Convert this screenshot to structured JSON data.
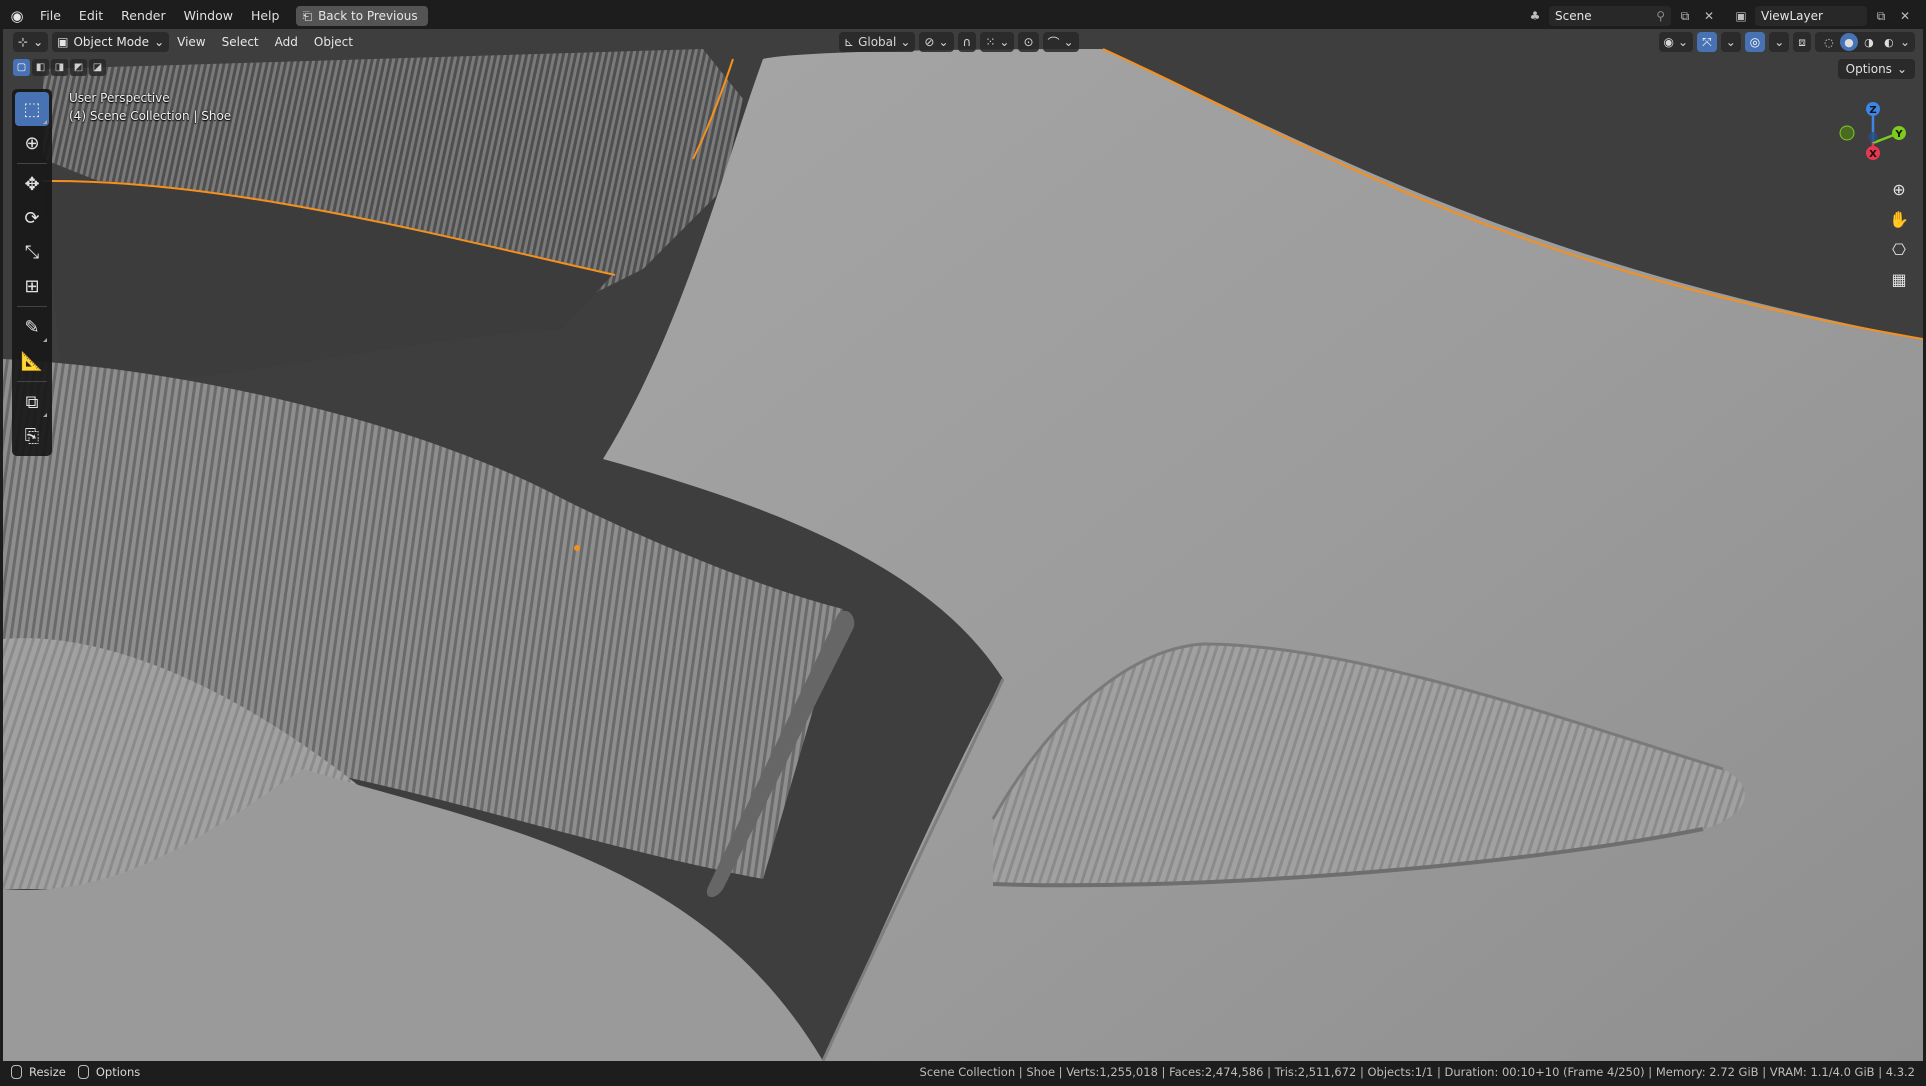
{
  "menubar": {
    "items": [
      "File",
      "Edit",
      "Render",
      "Window",
      "Help"
    ],
    "back_button": "Back to Previous",
    "scene_field": "Scene",
    "view_layer_field": "ViewLayer"
  },
  "viewport_header": {
    "mode": "Object Mode",
    "menus": [
      "View",
      "Select",
      "Add",
      "Object"
    ],
    "orientation": "Global",
    "options_label": "Options"
  },
  "overlay": {
    "view_name": "User Perspective",
    "collection_info": "(4) Scene Collection | Shoe"
  },
  "toolbar": {
    "tools": [
      {
        "icon": "select-box-icon",
        "active": true
      },
      {
        "icon": "cursor-icon"
      },
      {
        "icon": "move-icon"
      },
      {
        "icon": "rotate-icon"
      },
      {
        "icon": "scale-icon"
      },
      {
        "icon": "transform-icon"
      },
      {
        "icon": "annotate-icon"
      },
      {
        "icon": "measure-icon"
      },
      {
        "icon": "add-cube-icon"
      },
      {
        "icon": "add-object-icon"
      }
    ]
  },
  "gizmo": {
    "z_label": "Z",
    "y_label": "Y",
    "x_label": "X",
    "colors": {
      "x": "#e8384f",
      "y": "#7ecb20",
      "z": "#3b86e6"
    }
  },
  "statusbar": {
    "left_resize": "Resize",
    "left_options": "Options",
    "info": "Scene Collection | Shoe | Verts:1,255,018 | Faces:2,474,586 | Tris:2,511,672 | Objects:1/1 | Duration: 00:10+10 (Frame 4/250) | Memory: 2.72 GiB | VRAM: 1.1/4.0 GiB | 4.3.2"
  },
  "colors": {
    "accent": "#4772b3",
    "selection_outline": "#f5901d",
    "header_bg": "#1d1d1d",
    "viewport_bg": "#3d3d3d"
  }
}
